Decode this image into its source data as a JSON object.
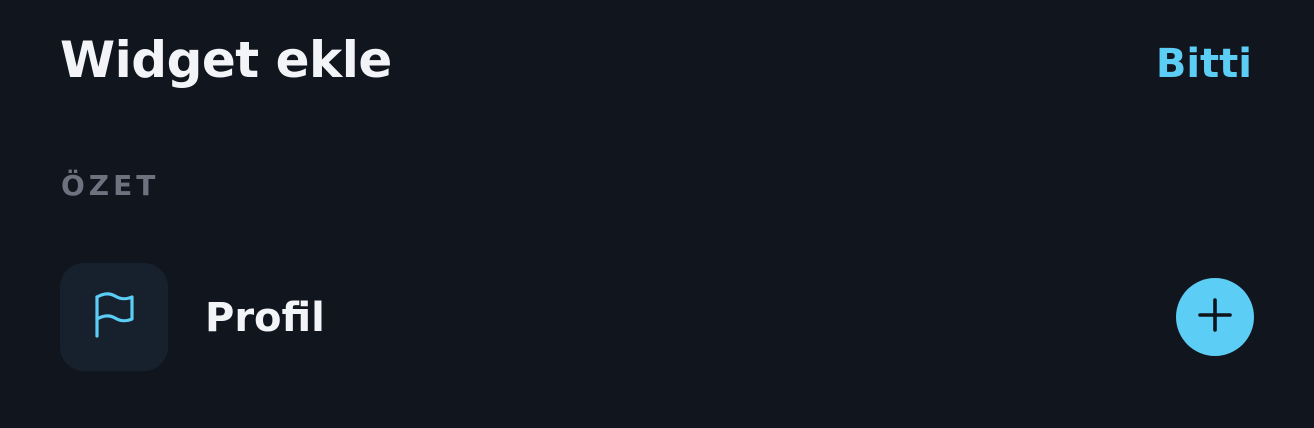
{
  "header": {
    "title": "Widget ekle",
    "done_label": "Bitti"
  },
  "sections": [
    {
      "title": "ÖZET",
      "items": [
        {
          "label": "Profil",
          "icon": "flag-icon",
          "action_icon": "plus-icon"
        }
      ]
    }
  ],
  "colors": {
    "background": "#11151d",
    "accent": "#5ccdf5",
    "text_primary": "#f2f4f7",
    "text_secondary": "#6c737f",
    "icon_box": "#16212d"
  }
}
